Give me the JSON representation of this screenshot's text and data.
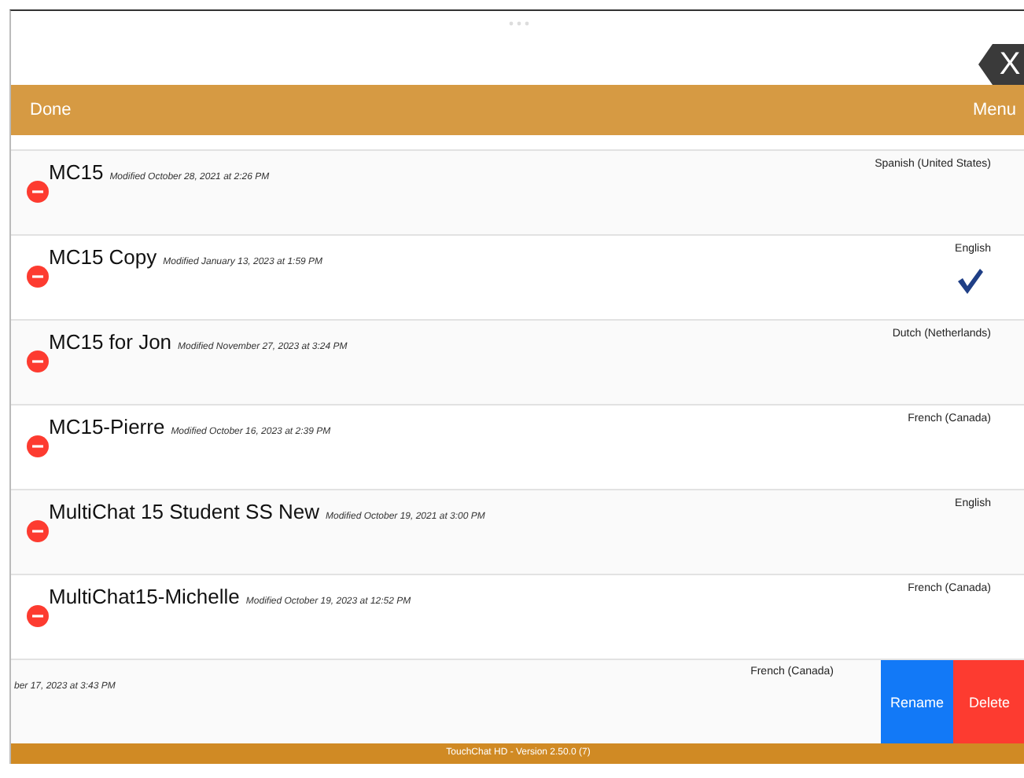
{
  "close_button": {
    "label": "X"
  },
  "toolbar": {
    "left": "Done",
    "right": "Menu"
  },
  "rows": [
    {
      "kind": "normal",
      "title": "MC15",
      "modified": "Modified October 28, 2021 at 2:26 PM",
      "language": "Spanish (United States)",
      "selected": false
    },
    {
      "kind": "normal",
      "title": "MC15 Copy",
      "modified": "Modified January 13, 2023 at 1:59 PM",
      "language": "English",
      "selected": true
    },
    {
      "kind": "normal",
      "title": "MC15 for Jon",
      "modified": "Modified November 27, 2023 at 3:24 PM",
      "language": "Dutch (Netherlands)",
      "selected": false
    },
    {
      "kind": "normal",
      "title": "MC15-Pierre",
      "modified": "Modified October 16, 2023 at 2:39 PM",
      "language": "French (Canada)",
      "selected": false
    },
    {
      "kind": "normal",
      "title": "MultiChat 15 Student SS New",
      "modified": "Modified October 19, 2021 at 3:00 PM",
      "language": "English",
      "selected": false
    },
    {
      "kind": "normal",
      "title": "MultiChat15-Michelle",
      "modified": "Modified October 19, 2023 at 12:52 PM",
      "language": "French (Canada)",
      "selected": false
    },
    {
      "kind": "swiped",
      "modified": "ber 17, 2023 at 3:43 PM",
      "language": "French (Canada)",
      "selected": false,
      "actions": [
        {
          "label": "Rename",
          "kind": "rename"
        },
        {
          "label": "Delete",
          "kind": "delete"
        }
      ]
    }
  ],
  "footer": "TouchChat HD - Version 2.50.0 (7)"
}
